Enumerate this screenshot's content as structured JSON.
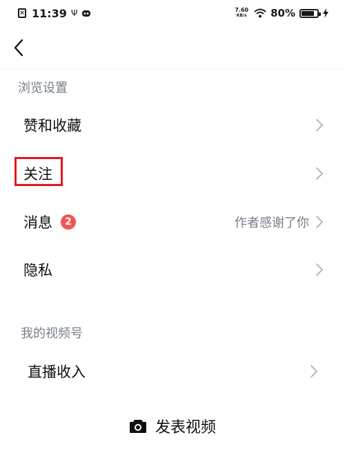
{
  "status_bar": {
    "time": "11:39",
    "usb_symbol": "Ψ",
    "net_speed_value": "7.60",
    "net_speed_unit": "KB/s",
    "battery_percent": "80%",
    "battery_level": 0.8
  },
  "nav": {
    "back_icon": "chevron-left-icon"
  },
  "sections": {
    "browse_settings": "浏览设置",
    "my_channel": "我的视频号"
  },
  "rows": {
    "likes": {
      "label": "赞和收藏"
    },
    "follow": {
      "label": "关注"
    },
    "messages": {
      "label": "消息",
      "badge": "2",
      "value": "作者感谢了你"
    },
    "privacy": {
      "label": "隐私"
    },
    "live_income": {
      "label": "直播收入"
    }
  },
  "bottom": {
    "post_label": "发表视频",
    "post_icon": "camera-icon"
  },
  "colors": {
    "badge": "#f25555",
    "highlight": "#e4161b",
    "secondary_text": "#777e88"
  }
}
